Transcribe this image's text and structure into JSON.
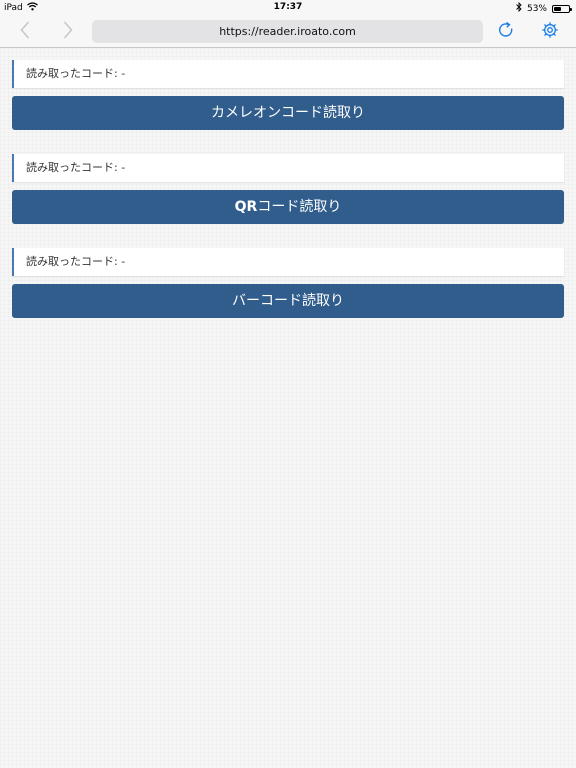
{
  "status_bar": {
    "device": "iPad",
    "time": "17:37",
    "battery_percent": "53%",
    "battery_level": 0.53,
    "icons": [
      "wifi-icon",
      "bluetooth-icon",
      "battery-icon"
    ]
  },
  "browser": {
    "url": "https://reader.iroato.com",
    "icons": [
      "back-arrow-icon",
      "forward-arrow-icon",
      "reload-icon",
      "gear-icon"
    ],
    "accent_color": "#1a7ee5"
  },
  "readers": [
    {
      "label": "読み取ったコード: -",
      "button": "カメレオンコード読取り"
    },
    {
      "label": "読み取ったコード: -",
      "button_prefix": "QR",
      "button_rest": "コード読取り"
    },
    {
      "label": "読み取ったコード: -",
      "button": "バーコード読取り"
    }
  ],
  "colors": {
    "button_bg": "#315d8d",
    "label_border": "#4a78b5",
    "page_bg": "#f6f6f6"
  }
}
